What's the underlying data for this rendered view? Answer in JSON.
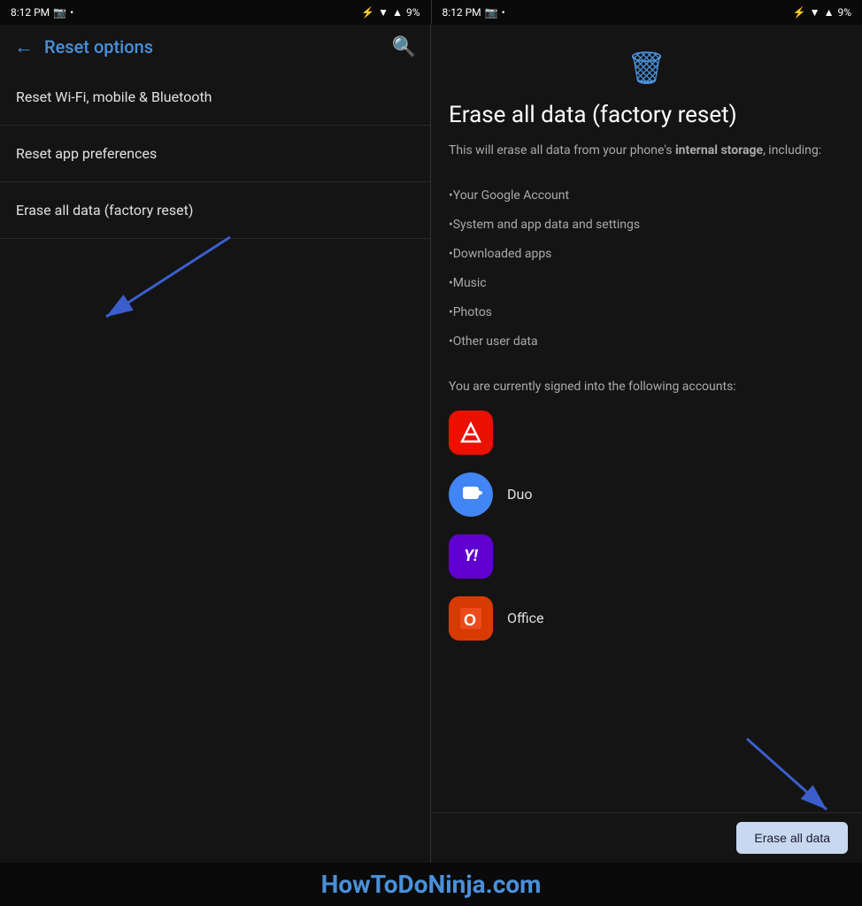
{
  "status": {
    "time": "8:12 PM",
    "battery": "9%"
  },
  "left_panel": {
    "title": "Reset options",
    "menu_items": [
      {
        "id": "wifi",
        "label": "Reset Wi-Fi, mobile & Bluetooth"
      },
      {
        "id": "app-prefs",
        "label": "Reset app preferences"
      },
      {
        "id": "factory",
        "label": "Erase all data (factory reset)"
      }
    ]
  },
  "right_panel": {
    "title": "Erase all data (factory reset)",
    "description_start": "This will erase all data from your phone's ",
    "description_bold": "internal storage",
    "description_end": ", including:",
    "data_items": [
      "•Your Google Account",
      "•System and app data and settings",
      "•Downloaded apps",
      "•Music",
      "•Photos",
      "•Other user data"
    ],
    "accounts_intro": "You are currently signed into the following accounts:",
    "accounts": [
      {
        "id": "adobe",
        "label": "",
        "color": "#eb1000",
        "text": "A"
      },
      {
        "id": "duo",
        "label": "Duo",
        "color": "#4285f4",
        "text": "▶"
      },
      {
        "id": "yahoo",
        "label": "",
        "color": "#6001d2",
        "text": "Y!"
      },
      {
        "id": "office",
        "label": "Office",
        "color": "#d83b01",
        "text": "O"
      }
    ],
    "erase_button": "Erase all data"
  },
  "footer": {
    "text": "HowToDoNinja.com"
  }
}
